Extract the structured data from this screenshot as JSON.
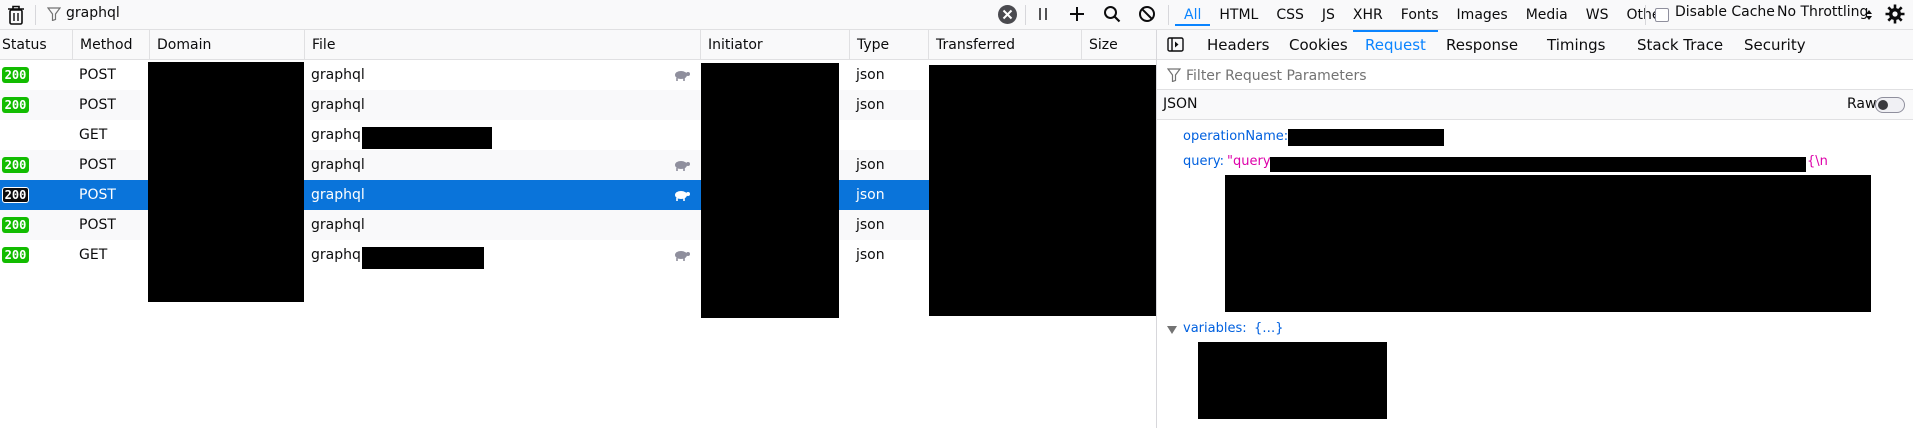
{
  "toolbar": {
    "filter_value": "graphql",
    "type_filters": [
      "All",
      "HTML",
      "CSS",
      "JS",
      "XHR",
      "Fonts",
      "Images",
      "Media",
      "WS",
      "Other"
    ],
    "active_type": "All",
    "disable_cache_label": "Disable Cache",
    "throttling_label": "No Throttling"
  },
  "table": {
    "columns": [
      "Status",
      "Method",
      "Domain",
      "File",
      "Initiator",
      "Type",
      "Transferred",
      "Size"
    ],
    "rows": [
      {
        "status": "200",
        "method": "POST",
        "file": "graphql",
        "type": "json"
      },
      {
        "status": "200",
        "method": "POST",
        "file": "graphql",
        "type": "json"
      },
      {
        "status": "",
        "method": "GET",
        "file": "graphql",
        "type": ""
      },
      {
        "status": "200",
        "method": "POST",
        "file": "graphql",
        "type": "json"
      },
      {
        "status": "200",
        "method": "POST",
        "file": "graphql",
        "type": "json"
      },
      {
        "status": "200",
        "method": "POST",
        "file": "graphql",
        "type": "json"
      },
      {
        "status": "200",
        "method": "GET",
        "file": "graphql",
        "type": "json"
      }
    ]
  },
  "panel": {
    "tabs": [
      "Headers",
      "Cookies",
      "Request",
      "Response",
      "Timings",
      "Stack Trace",
      "Security"
    ],
    "active_tab": "Request",
    "filter_placeholder": "Filter Request Parameters",
    "json_label": "JSON",
    "raw_label": "Raw",
    "operation_name_key": "operationName:",
    "query_key": "query:",
    "query_prefix": "\"query",
    "query_suffix": "{\\n",
    "variables_key": "variables:",
    "variables_value": "{…}"
  },
  "colors": {
    "accent": "#0a84ff",
    "selected_row": "#0a74da",
    "status_ok": "#12bc00"
  }
}
